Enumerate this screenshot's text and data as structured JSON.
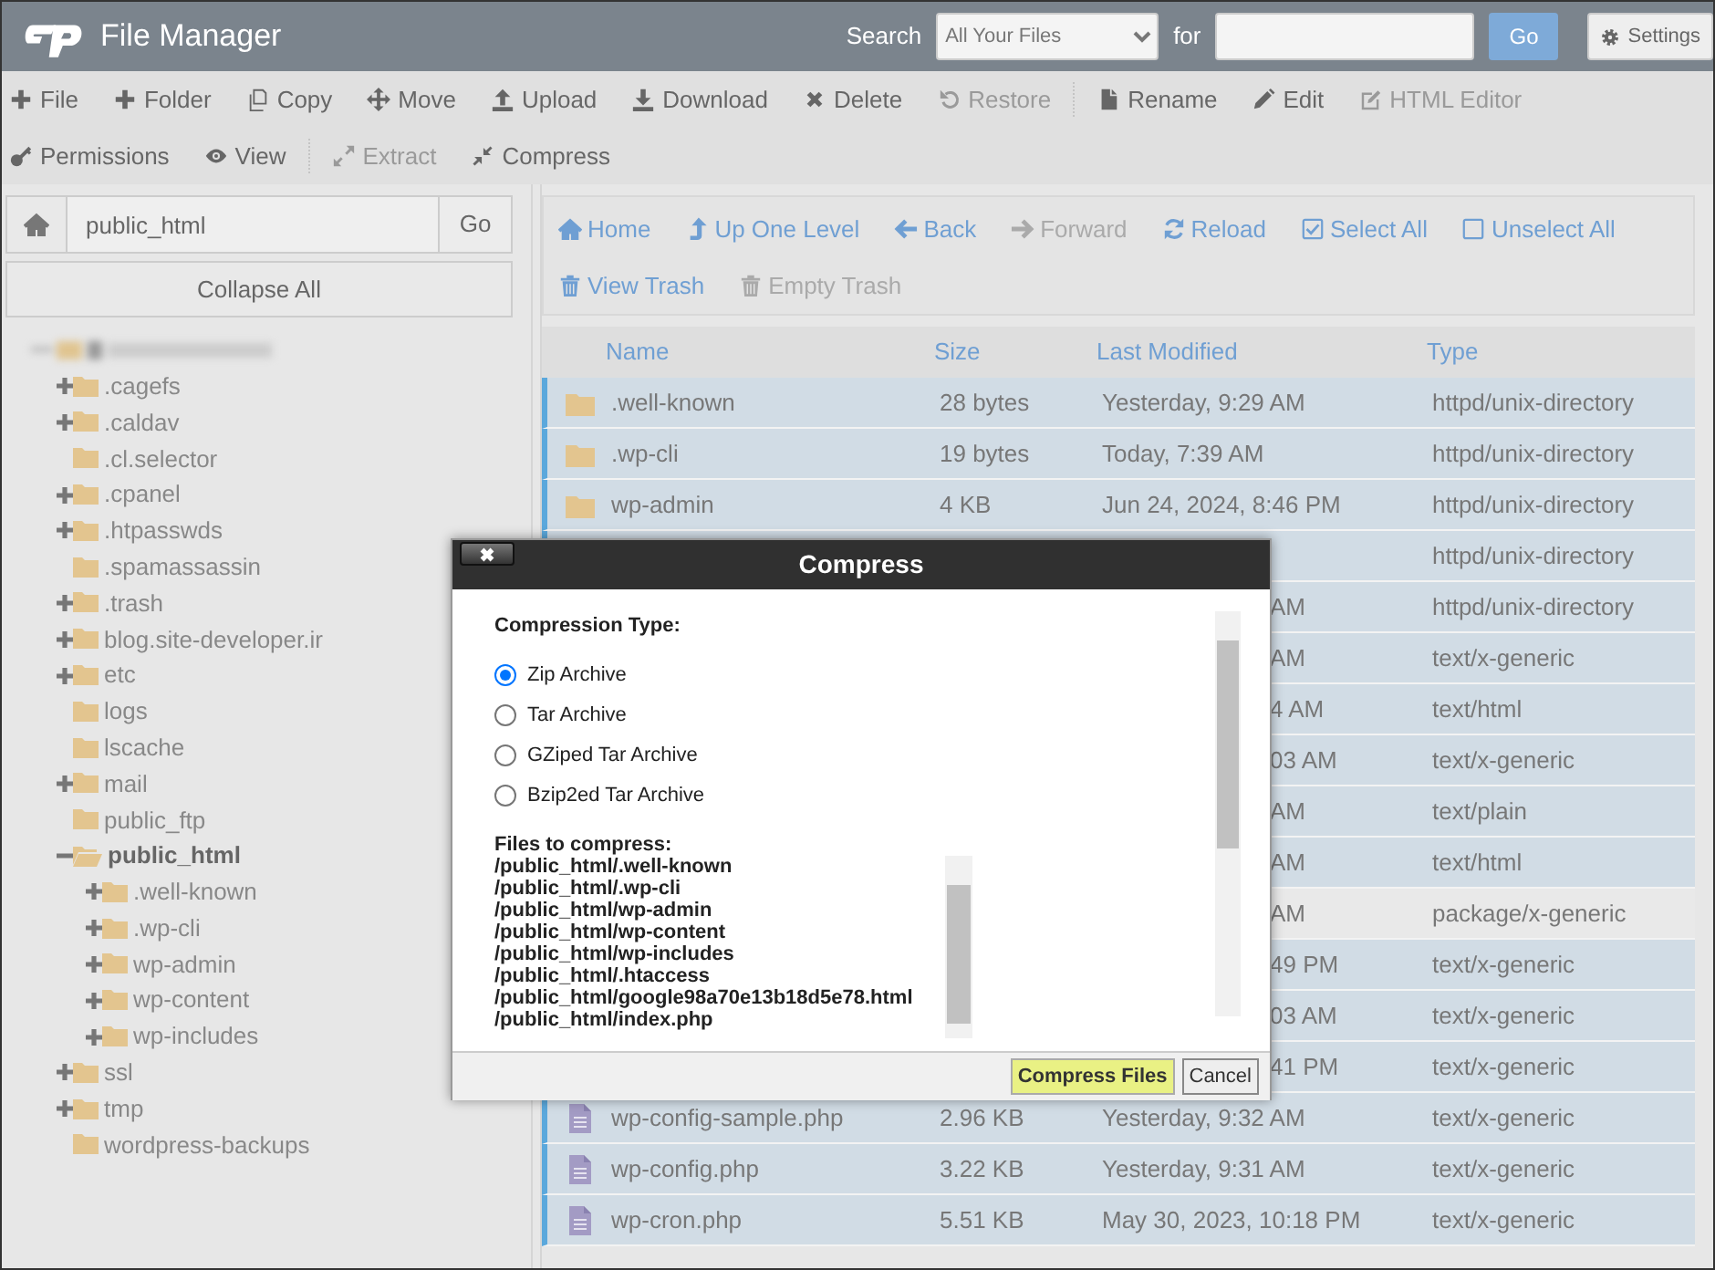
{
  "header": {
    "title": "File Manager",
    "search_label": "Search",
    "search_scope": "All Your Files",
    "for_label": "for",
    "go": "Go",
    "settings": "Settings"
  },
  "toolbar": {
    "rows": [
      {
        "groups": [
          {
            "buttons": [
              {
                "label": "File",
                "disabled": false
              },
              {
                "label": "Folder",
                "disabled": false
              },
              {
                "label": "Copy",
                "disabled": false
              },
              {
                "label": "Move",
                "disabled": false
              },
              {
                "label": "Upload",
                "disabled": false
              },
              {
                "label": "Download",
                "disabled": false
              },
              {
                "label": "Delete",
                "disabled": false
              },
              {
                "label": "Restore",
                "disabled": true
              }
            ]
          },
          {
            "buttons": [
              {
                "label": "Rename",
                "disabled": false
              },
              {
                "label": "Edit",
                "disabled": false
              },
              {
                "label": "HTML Editor",
                "disabled": true
              }
            ]
          }
        ]
      },
      {
        "groups": [
          {
            "buttons": [
              {
                "label": "Permissions",
                "disabled": false
              },
              {
                "label": "View",
                "disabled": false
              }
            ]
          },
          {
            "buttons": [
              {
                "label": "Extract",
                "disabled": true
              },
              {
                "label": "Compress",
                "disabled": false
              }
            ]
          }
        ]
      }
    ]
  },
  "sidebar": {
    "path": "public_html",
    "go": "Go",
    "collapse_all": "Collapse All",
    "tree": [
      {
        "label": ".cagefs",
        "expandable": true,
        "expanded": false,
        "selected": false
      },
      {
        "label": ".caldav",
        "expandable": true,
        "expanded": false,
        "selected": false
      },
      {
        "label": ".cl.selector",
        "expandable": false,
        "expanded": false,
        "selected": false
      },
      {
        "label": ".cpanel",
        "expandable": true,
        "expanded": false,
        "selected": false
      },
      {
        "label": ".htpasswds",
        "expandable": true,
        "expanded": false,
        "selected": false
      },
      {
        "label": ".spamassassin",
        "expandable": false,
        "expanded": false,
        "selected": false
      },
      {
        "label": ".trash",
        "expandable": true,
        "expanded": false,
        "selected": false
      },
      {
        "label": "blog.site-developer.ir",
        "expandable": true,
        "expanded": false,
        "selected": false
      },
      {
        "label": "etc",
        "expandable": true,
        "expanded": false,
        "selected": false
      },
      {
        "label": "logs",
        "expandable": false,
        "expanded": false,
        "selected": false
      },
      {
        "label": "lscache",
        "expandable": false,
        "expanded": false,
        "selected": false
      },
      {
        "label": "mail",
        "expandable": true,
        "expanded": false,
        "selected": false
      },
      {
        "label": "public_ftp",
        "expandable": false,
        "expanded": false,
        "selected": false
      },
      {
        "label": "public_html",
        "expandable": true,
        "expanded": true,
        "selected": true,
        "children": [
          {
            "label": ".well-known",
            "expandable": true,
            "expanded": false,
            "selected": false
          },
          {
            "label": ".wp-cli",
            "expandable": true,
            "expanded": false,
            "selected": false
          },
          {
            "label": "wp-admin",
            "expandable": true,
            "expanded": false,
            "selected": false
          },
          {
            "label": "wp-content",
            "expandable": true,
            "expanded": false,
            "selected": false
          },
          {
            "label": "wp-includes",
            "expandable": true,
            "expanded": false,
            "selected": false
          }
        ]
      },
      {
        "label": "ssl",
        "expandable": true,
        "expanded": false,
        "selected": false
      },
      {
        "label": "tmp",
        "expandable": true,
        "expanded": false,
        "selected": false
      },
      {
        "label": "wordpress-backups",
        "expandable": false,
        "expanded": false,
        "selected": false
      }
    ]
  },
  "navigation": {
    "rows": [
      [
        {
          "label": "Home",
          "disabled": false
        },
        {
          "label": "Up One Level",
          "disabled": false
        },
        {
          "label": "Back",
          "disabled": false
        },
        {
          "label": "Forward",
          "disabled": true
        },
        {
          "label": "Reload",
          "disabled": false
        },
        {
          "label": "Select All",
          "disabled": false
        },
        {
          "label": "Unselect All",
          "disabled": false
        }
      ],
      [
        {
          "label": "View Trash",
          "disabled": false
        },
        {
          "label": "Empty Trash",
          "disabled": true
        }
      ]
    ]
  },
  "table": {
    "columns": [
      "Name",
      "Size",
      "Last Modified",
      "Type"
    ],
    "rows": [
      {
        "kind": "folder",
        "covered": false,
        "name": ".well-known",
        "size": "28 bytes",
        "last_modified": "Yesterday, 9:29 AM",
        "type": "httpd/unix-directory",
        "selected": true
      },
      {
        "kind": "folder",
        "covered": false,
        "name": ".wp-cli",
        "size": "19 bytes",
        "last_modified": "Today, 7:39 AM",
        "type": "httpd/unix-directory",
        "selected": true
      },
      {
        "kind": "folder",
        "covered": false,
        "name": "wp-admin",
        "size": "4 KB",
        "last_modified": "Jun 24, 2024, 8:46 PM",
        "type": "httpd/unix-directory",
        "selected": true
      },
      {
        "covered": true,
        "type": "httpd/unix-directory",
        "selected": true
      },
      {
        "covered": true,
        "last_modified": "AM",
        "type": "httpd/unix-directory",
        "selected": true
      },
      {
        "covered": true,
        "last_modified": "AM",
        "type": "text/x-generic",
        "selected": true
      },
      {
        "covered": true,
        "last_modified": "4 AM",
        "type": "text/html",
        "selected": true
      },
      {
        "covered": true,
        "last_modified": "03 AM",
        "type": "text/x-generic",
        "selected": true
      },
      {
        "covered": true,
        "last_modified": "AM",
        "type": "text/plain",
        "selected": true
      },
      {
        "covered": true,
        "last_modified": "AM",
        "type": "text/html",
        "selected": true
      },
      {
        "covered": true,
        "last_modified": "AM",
        "type": "package/x-generic",
        "selected": false
      },
      {
        "covered": true,
        "last_modified": "49 PM",
        "type": "text/x-generic",
        "selected": true
      },
      {
        "covered": true,
        "last_modified": "03 AM",
        "type": "text/x-generic",
        "selected": true
      },
      {
        "covered": true,
        "last_modified": "41 PM",
        "type": "text/x-generic",
        "selected": true
      },
      {
        "kind": "file",
        "covered": false,
        "name": "wp-config-sample.php",
        "size": "2.96 KB",
        "last_modified": "Yesterday, 9:32 AM",
        "type": "text/x-generic",
        "selected": true
      },
      {
        "kind": "file",
        "covered": false,
        "name": "wp-config.php",
        "size": "3.22 KB",
        "last_modified": "Yesterday, 9:31 AM",
        "type": "text/x-generic",
        "selected": true
      },
      {
        "kind": "file",
        "covered": false,
        "name": "wp-cron.php",
        "size": "5.51 KB",
        "last_modified": "May 30, 2023, 10:18 PM",
        "type": "text/x-generic",
        "selected": true
      }
    ]
  },
  "dialog": {
    "title": "Compress",
    "type_label": "Compression Type:",
    "options": [
      {
        "label": "Zip Archive",
        "selected": true
      },
      {
        "label": "Tar Archive",
        "selected": false
      },
      {
        "label": "GZiped Tar Archive",
        "selected": false
      },
      {
        "label": "Bzip2ed Tar Archive",
        "selected": false
      }
    ],
    "files_label": "Files to compress:",
    "files": [
      "/public_html/.well-known",
      "/public_html/.wp-cli",
      "/public_html/wp-admin",
      "/public_html/wp-content",
      "/public_html/wp-includes",
      "/public_html/.htaccess",
      "/public_html/google98a70e13b18d5e78.html",
      "/public_html/index.php"
    ],
    "buttons": {
      "primary": "Compress Files",
      "cancel": "Cancel"
    }
  }
}
